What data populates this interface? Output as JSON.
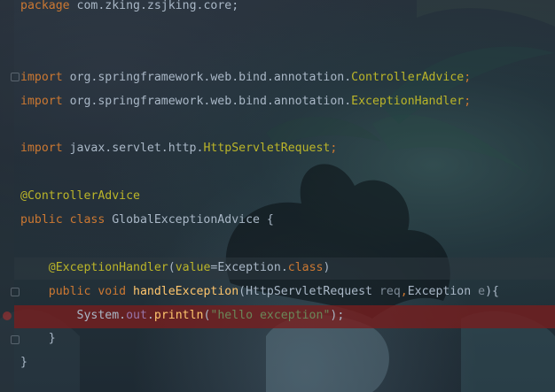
{
  "editor": {
    "lines": [
      {
        "segments": [
          {
            "t": "package ",
            "c": "kw"
          },
          {
            "t": "com.zking.zsjking.core;",
            "c": "cls"
          }
        ]
      },
      {
        "segments": []
      },
      {
        "segments": []
      },
      {
        "segments": [
          {
            "t": "import ",
            "c": "kw"
          },
          {
            "t": "org.springframework.web.bind.annotation.",
            "c": "cls"
          },
          {
            "t": "ControllerAdvice",
            "c": "ann"
          },
          {
            "t": ";",
            "c": "kw"
          }
        ]
      },
      {
        "segments": [
          {
            "t": "import ",
            "c": "kw"
          },
          {
            "t": "org.springframework.web.bind.annotation.",
            "c": "cls"
          },
          {
            "t": "ExceptionHandler",
            "c": "ann"
          },
          {
            "t": ";",
            "c": "kw"
          }
        ]
      },
      {
        "segments": []
      },
      {
        "segments": [
          {
            "t": "import ",
            "c": "kw"
          },
          {
            "t": "javax.servlet.http.",
            "c": "cls"
          },
          {
            "t": "HttpServletRequest",
            "c": "ann"
          },
          {
            "t": ";",
            "c": "kw"
          }
        ]
      },
      {
        "segments": []
      },
      {
        "segments": [
          {
            "t": "@ControllerAdvice",
            "c": "ann"
          }
        ]
      },
      {
        "segments": [
          {
            "t": "public class ",
            "c": "kw"
          },
          {
            "t": "GlobalExceptionAdvice {",
            "c": "cls"
          }
        ]
      },
      {
        "segments": []
      },
      {
        "segments": [
          {
            "t": "    @ExceptionHandler",
            "c": "ann"
          },
          {
            "t": "(",
            "c": "cls"
          },
          {
            "t": "value",
            "c": "ann"
          },
          {
            "t": "=",
            "c": "cls"
          },
          {
            "t": "Exception",
            "c": "cls"
          },
          {
            "t": ".",
            "c": "cls"
          },
          {
            "t": "class",
            "c": "kw"
          },
          {
            "t": ")",
            "c": "cls"
          }
        ]
      },
      {
        "segments": [
          {
            "t": "    public void ",
            "c": "kw"
          },
          {
            "t": "handleException",
            "c": "fn"
          },
          {
            "t": "(HttpServletRequest ",
            "c": "cls"
          },
          {
            "t": "req",
            "c": "param-unused"
          },
          {
            "t": ",",
            "c": "kw"
          },
          {
            "t": "Exception ",
            "c": "cls"
          },
          {
            "t": "e",
            "c": "param-unused"
          },
          {
            "t": "){",
            "c": "cls"
          }
        ]
      },
      {
        "segments": [
          {
            "t": "        System.",
            "c": "cls"
          },
          {
            "t": "out",
            "c": "fld"
          },
          {
            "t": ".",
            "c": "cls"
          },
          {
            "t": "println",
            "c": "fn"
          },
          {
            "t": "(",
            "c": "cls"
          },
          {
            "t": "\"hello exception\"",
            "c": "str"
          },
          {
            "t": ");",
            "c": "cls"
          }
        ]
      },
      {
        "segments": [
          {
            "t": "    }",
            "c": "cls"
          }
        ]
      },
      {
        "segments": [
          {
            "t": "}",
            "c": "cls"
          }
        ]
      }
    ]
  }
}
